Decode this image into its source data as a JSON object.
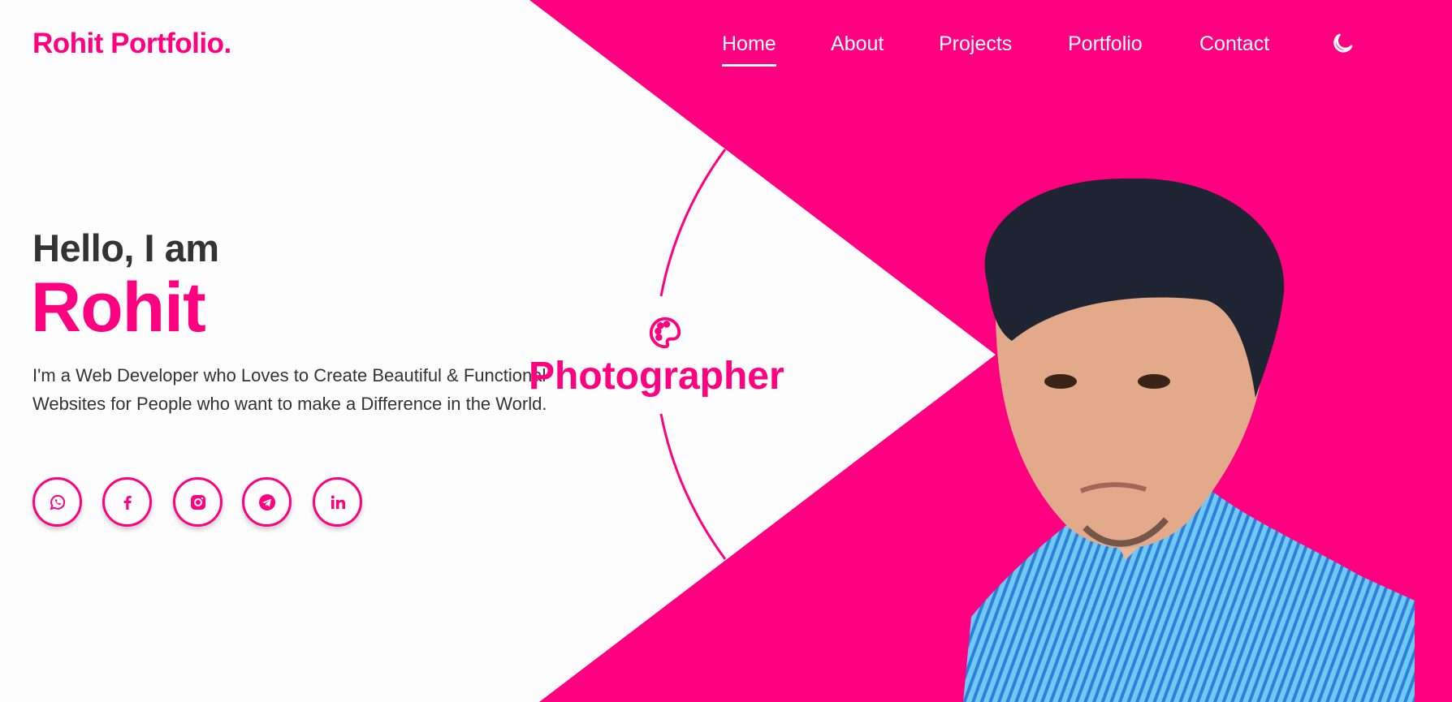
{
  "colors": {
    "accent": "#ff0080",
    "text": "#333333",
    "background": "#fdfdfd"
  },
  "header": {
    "logo": "Rohit Portfolio.",
    "nav": [
      {
        "label": "Home",
        "active": true
      },
      {
        "label": "About"
      },
      {
        "label": "Projects"
      },
      {
        "label": "Portfolio"
      },
      {
        "label": "Contact"
      }
    ],
    "theme_toggle_icon": "moon-icon"
  },
  "hero": {
    "greeting": "Hello, I am",
    "name": "Rohit",
    "description": "I'm a Web Developer who Loves to Create Beautiful & Functional Websites for People who want to make a Difference in the World.",
    "role_icon": "palette-icon",
    "role": "Photographer",
    "socials": [
      {
        "icon": "whatsapp-icon"
      },
      {
        "icon": "facebook-icon"
      },
      {
        "icon": "instagram-icon"
      },
      {
        "icon": "telegram-icon"
      },
      {
        "icon": "linkedin-icon"
      }
    ],
    "photo": "profile-photo"
  }
}
